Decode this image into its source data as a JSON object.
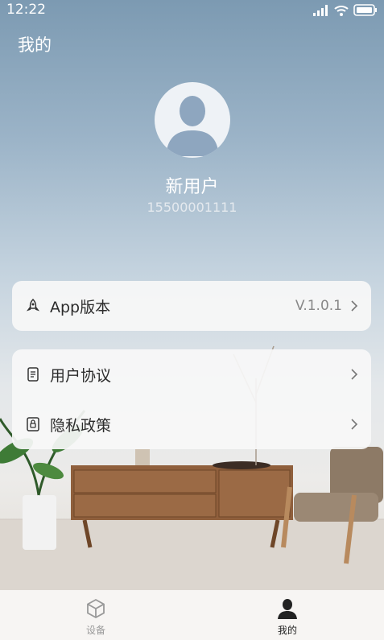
{
  "status_bar": {
    "time": "12:22"
  },
  "header": {
    "title": "我的"
  },
  "profile": {
    "name": "新用户",
    "phone": "15500001111"
  },
  "menu": {
    "app_version": {
      "label": "App版本",
      "value": "V.1.0.1",
      "icon": "rocket-icon"
    },
    "user_agreement": {
      "label": "用户协议",
      "icon": "document-icon"
    },
    "privacy_policy": {
      "label": "隐私政策",
      "icon": "lock-icon"
    }
  },
  "tabbar": {
    "tabs": [
      {
        "label": "设备",
        "icon": "cube-icon",
        "active": false
      },
      {
        "label": "我的",
        "icon": "person-icon",
        "active": true
      }
    ]
  }
}
